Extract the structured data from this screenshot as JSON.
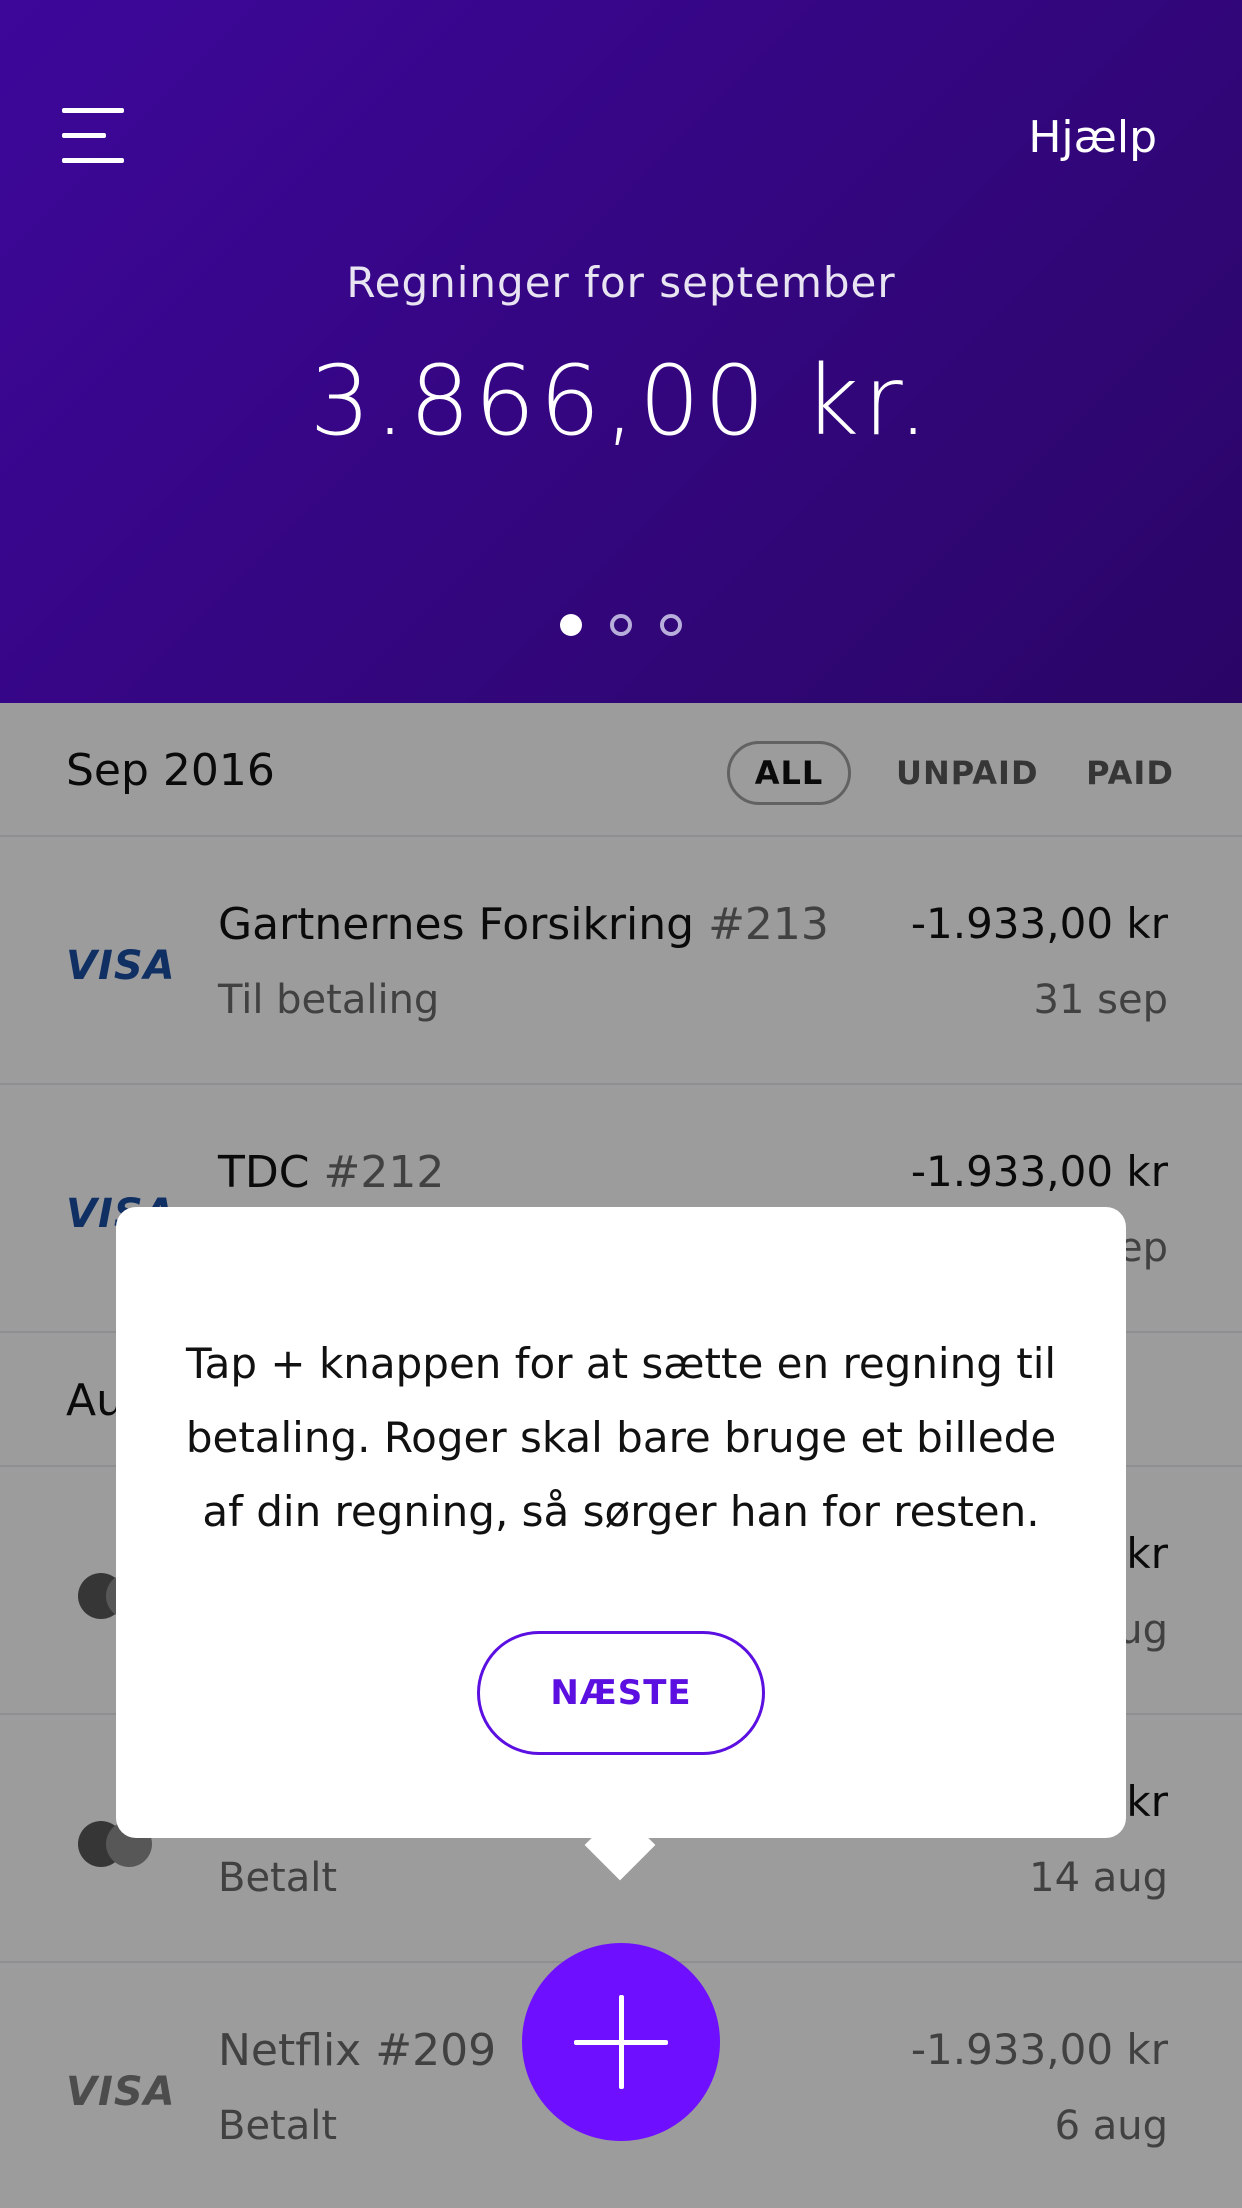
{
  "header": {
    "help_label": "Hjælp",
    "subtitle": "Regninger for september",
    "amount": "3.866,00 kr."
  },
  "list": {
    "month": "Sep 2016",
    "filters": {
      "all": "ALL",
      "unpaid": "UNPAID",
      "paid": "PAID"
    },
    "bills": [
      {
        "card": "VISA",
        "name": "Gartnernes Forsikring",
        "number": "#213",
        "status": "Til betaling",
        "amount": "-1.933,00 kr",
        "date": "31 sep"
      },
      {
        "card": "VISA",
        "name": "TDC",
        "number": "#212",
        "status": "",
        "amount": "-1.933,00 kr",
        "date": "ep"
      }
    ],
    "month2": "Au",
    "bills2": [
      {
        "amount": "kr",
        "date": "ug"
      },
      {
        "status": "Betalt",
        "amount": "kr",
        "date": "14 aug"
      },
      {
        "card": "VISA",
        "name": "Netflix",
        "number": "#209",
        "status": "Betalt",
        "amount": "-1.933,00 kr",
        "date": "6 aug"
      }
    ]
  },
  "tooltip": {
    "text": "Tap + knappen for at sætte en regning til betaling. Roger skal bare bruge et billede af din regning, så sørger han for resten.",
    "next_label": "NÆSTE"
  },
  "colors": {
    "header_bg": "#33067e",
    "accent": "#6e10ff",
    "button_border": "#5b0fe0"
  }
}
